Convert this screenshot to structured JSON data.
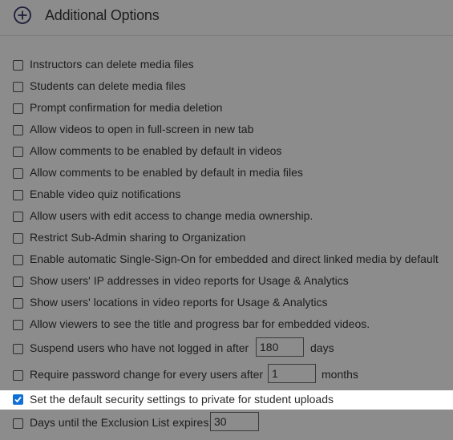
{
  "header": {
    "title": "Additional Options",
    "icon": "plus-circle-icon"
  },
  "options": [
    {
      "label": "Instructors can delete media files",
      "checked": false
    },
    {
      "label": "Students can delete media files",
      "checked": false
    },
    {
      "label": "Prompt confirmation for media deletion",
      "checked": false
    },
    {
      "label": "Allow videos to open in full-screen in new tab",
      "checked": false
    },
    {
      "label": "Allow comments to be enabled by default in videos",
      "checked": false
    },
    {
      "label": "Allow comments to be enabled by default in media files",
      "checked": false
    },
    {
      "label": "Enable video quiz notifications",
      "checked": false
    },
    {
      "label": "Allow users with edit access to change media ownership.",
      "checked": false
    },
    {
      "label": "Restrict Sub-Admin sharing to Organization",
      "checked": false
    },
    {
      "label": "Enable automatic Single-Sign-On for embedded and direct linked media by default",
      "checked": false
    },
    {
      "label": "Show users' IP addresses in video reports for Usage & Analytics",
      "checked": false
    },
    {
      "label": "Show users' locations in video reports for Usage & Analytics",
      "checked": false
    },
    {
      "label": "Allow viewers to see the title and progress bar for embedded videos.",
      "checked": false
    }
  ],
  "suspend": {
    "label": "Suspend users who have not logged in after",
    "value": "180",
    "unit": "days",
    "checked": false
  },
  "password": {
    "label": "Require password change for every users after",
    "value": "1",
    "unit": "months",
    "checked": false
  },
  "security": {
    "label": "Set the default security settings to private for student uploads",
    "checked": true
  },
  "exclusion": {
    "label": "Days until the Exclusion List expires:",
    "value": "30",
    "checked": false
  },
  "colors": {
    "overlay": "#8c8c8c",
    "checkbox_checked": "#0f6fd6",
    "highlight": "#ffffff"
  }
}
